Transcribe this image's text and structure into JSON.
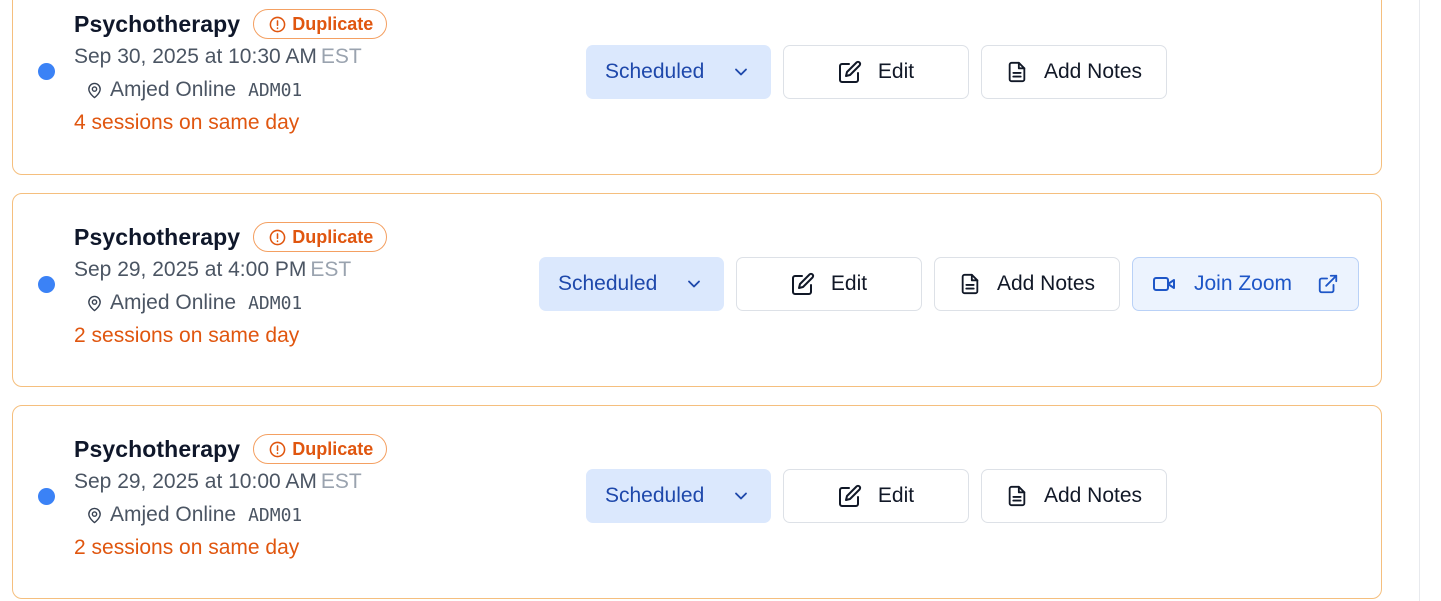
{
  "sessions": [
    {
      "title": "Psychotherapy",
      "badge": "Duplicate",
      "datetime": "Sep 30, 2025 at 10:30 AM",
      "timezone": "EST",
      "location": "Amjed Online",
      "location_code": "ADM01",
      "same_day_note": "4 sessions on same day",
      "status": "Scheduled",
      "edit_label": "Edit",
      "notes_label": "Add Notes"
    },
    {
      "title": "Psychotherapy",
      "badge": "Duplicate",
      "datetime": "Sep 29, 2025 at 4:00 PM",
      "timezone": "EST",
      "location": "Amjed Online",
      "location_code": "ADM01",
      "same_day_note": "2 sessions on same day",
      "status": "Scheduled",
      "edit_label": "Edit",
      "notes_label": "Add Notes",
      "zoom_label": "Join Zoom"
    },
    {
      "title": "Psychotherapy",
      "badge": "Duplicate",
      "datetime": "Sep 29, 2025 at 10:00 AM",
      "timezone": "EST",
      "location": "Amjed Online",
      "location_code": "ADM01",
      "same_day_note": "2 sessions on same day",
      "status": "Scheduled",
      "edit_label": "Edit",
      "notes_label": "Add Notes"
    }
  ],
  "icons": {
    "status_dot": "status-dot",
    "badge": "alert-circle-icon",
    "location": "map-pin-icon",
    "status_dropdown": "chevron-down-icon",
    "edit": "edit-square-icon",
    "notes": "file-text-icon",
    "zoom": "video-camera-icon",
    "external": "external-link-icon"
  },
  "colors": {
    "card_border": "#f5bf7e",
    "status_dot": "#3b82f6",
    "warning_text": "#e0560f",
    "status_bg": "#dbe8fd",
    "status_text": "#1e48ab",
    "zoom_bg": "#ecf3fe",
    "zoom_text": "#1e56c7"
  }
}
